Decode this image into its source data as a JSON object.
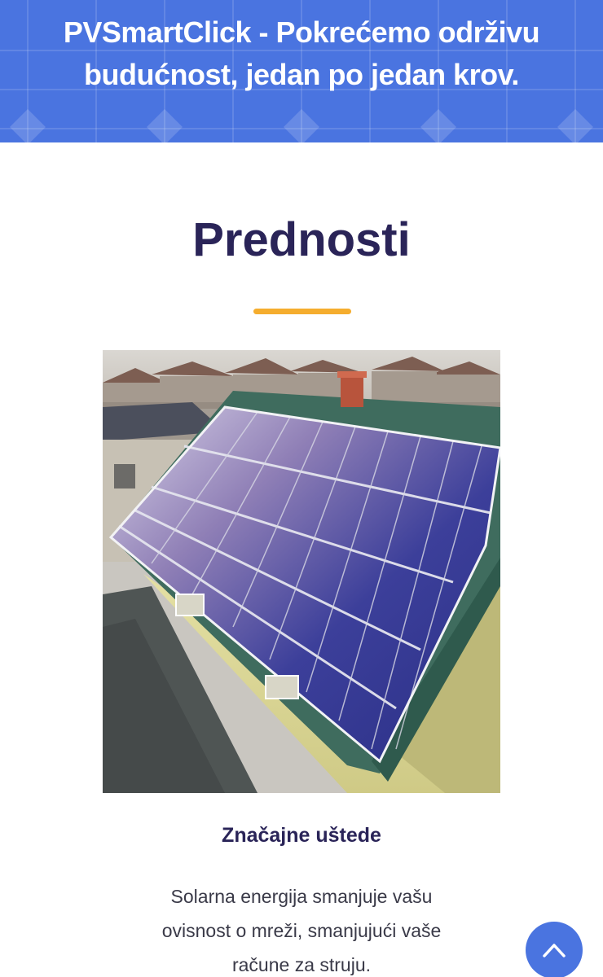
{
  "hero": {
    "title": "PVSmartClick - Pokrećemo održivu budućnost, jedan po jedan krov."
  },
  "section": {
    "title": "Prednosti"
  },
  "feature": {
    "title": "Značajne uštede",
    "text": "Solarna energija smanjuje vašu ovisnost o mreži, smanjujući vaše račune za struju."
  },
  "icons": {
    "scroll_top": "chevron-up-icon"
  },
  "colors": {
    "hero_background": "#4a74e0",
    "heading": "#2a2458",
    "accent": "#f5ad2e",
    "body_text": "#3a3a48"
  }
}
